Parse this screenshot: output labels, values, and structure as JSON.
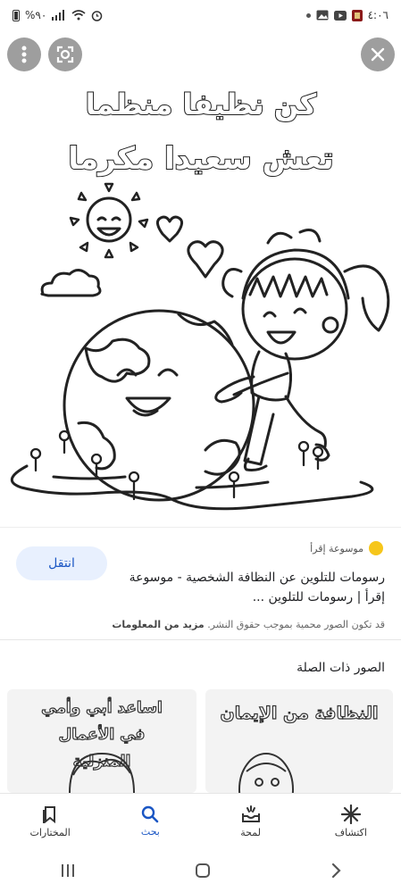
{
  "status_bar": {
    "time": "٤:٠٦",
    "battery": "%٩٠"
  },
  "hero": {
    "title_line1": "كن نظيفا منظما",
    "title_line2": "تعش سعيدا مكرما"
  },
  "result": {
    "source": "موسوعة إقرأ",
    "action_label": "انتقل",
    "description": "رسومات للتلوين عن النظافة الشخصية - موسوعة إقرأ | رسومات للتلوين ...",
    "copyright_notice": "قد تكون الصور محمية بموجب حقوق النشر.",
    "more_info": "مزيد من المعلومات"
  },
  "related": {
    "title": "الصور ذات الصلة",
    "items": [
      {
        "text": "النظافة من الإيمان"
      },
      {
        "text": "اساعد أبي وأمي في الأعمال المنزلية"
      }
    ]
  },
  "bottom_nav": {
    "items": [
      {
        "label": "اكتشاف",
        "icon": "asterisk-icon"
      },
      {
        "label": "لمحة",
        "icon": "inbox-icon"
      },
      {
        "label": "بحث",
        "icon": "search-icon"
      },
      {
        "label": "المختارات",
        "icon": "bookmark-icon"
      }
    ],
    "active_color": "#1a56c4"
  }
}
